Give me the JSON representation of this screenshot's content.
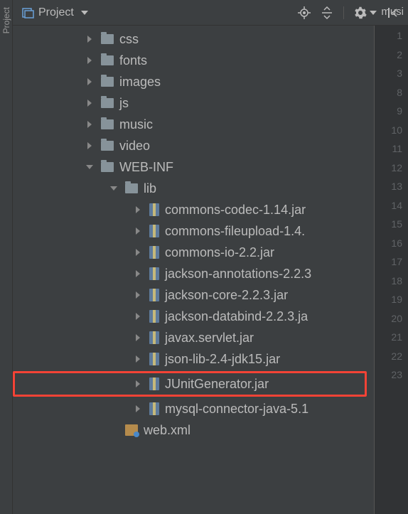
{
  "toolbar": {
    "title": "Project"
  },
  "editor_tab_partial": "musi",
  "tree": {
    "items": [
      {
        "type": "folder",
        "label": "css",
        "indent": 3,
        "expanded": false
      },
      {
        "type": "folder",
        "label": "fonts",
        "indent": 3,
        "expanded": false
      },
      {
        "type": "folder",
        "label": "images",
        "indent": 3,
        "expanded": false
      },
      {
        "type": "folder",
        "label": "js",
        "indent": 3,
        "expanded": false
      },
      {
        "type": "folder",
        "label": "music",
        "indent": 3,
        "expanded": false
      },
      {
        "type": "folder",
        "label": "video",
        "indent": 3,
        "expanded": false
      },
      {
        "type": "folder",
        "label": "WEB-INF",
        "indent": 3,
        "expanded": true
      },
      {
        "type": "folder",
        "label": "lib",
        "indent": 4,
        "expanded": true
      },
      {
        "type": "archive",
        "label": "commons-codec-1.14.jar",
        "indent": 5,
        "expanded": false
      },
      {
        "type": "archive",
        "label": "commons-fileupload-1.4.",
        "indent": 5,
        "expanded": false
      },
      {
        "type": "archive",
        "label": "commons-io-2.2.jar",
        "indent": 5,
        "expanded": false
      },
      {
        "type": "archive",
        "label": "jackson-annotations-2.2.3",
        "indent": 5,
        "expanded": false
      },
      {
        "type": "archive",
        "label": "jackson-core-2.2.3.jar",
        "indent": 5,
        "expanded": false
      },
      {
        "type": "archive",
        "label": "jackson-databind-2.2.3.ja",
        "indent": 5,
        "expanded": false
      },
      {
        "type": "archive",
        "label": "javax.servlet.jar",
        "indent": 5,
        "expanded": false
      },
      {
        "type": "archive",
        "label": "json-lib-2.4-jdk15.jar",
        "indent": 5,
        "expanded": false
      },
      {
        "type": "archive",
        "label": "JUnitGenerator.jar",
        "indent": 5,
        "expanded": false,
        "highlighted": true
      },
      {
        "type": "archive",
        "label": "mysql-connector-java-5.1",
        "indent": 5,
        "expanded": false
      },
      {
        "type": "xml",
        "label": "web.xml",
        "indent": 4,
        "no_arrow": true
      }
    ]
  },
  "gutter_lines": [
    "1",
    "2",
    "3",
    "8",
    "9",
    "10",
    "11",
    "12",
    "13",
    "14",
    "15",
    "16",
    "17",
    "18",
    "19",
    "20",
    "21",
    "22",
    "23"
  ]
}
